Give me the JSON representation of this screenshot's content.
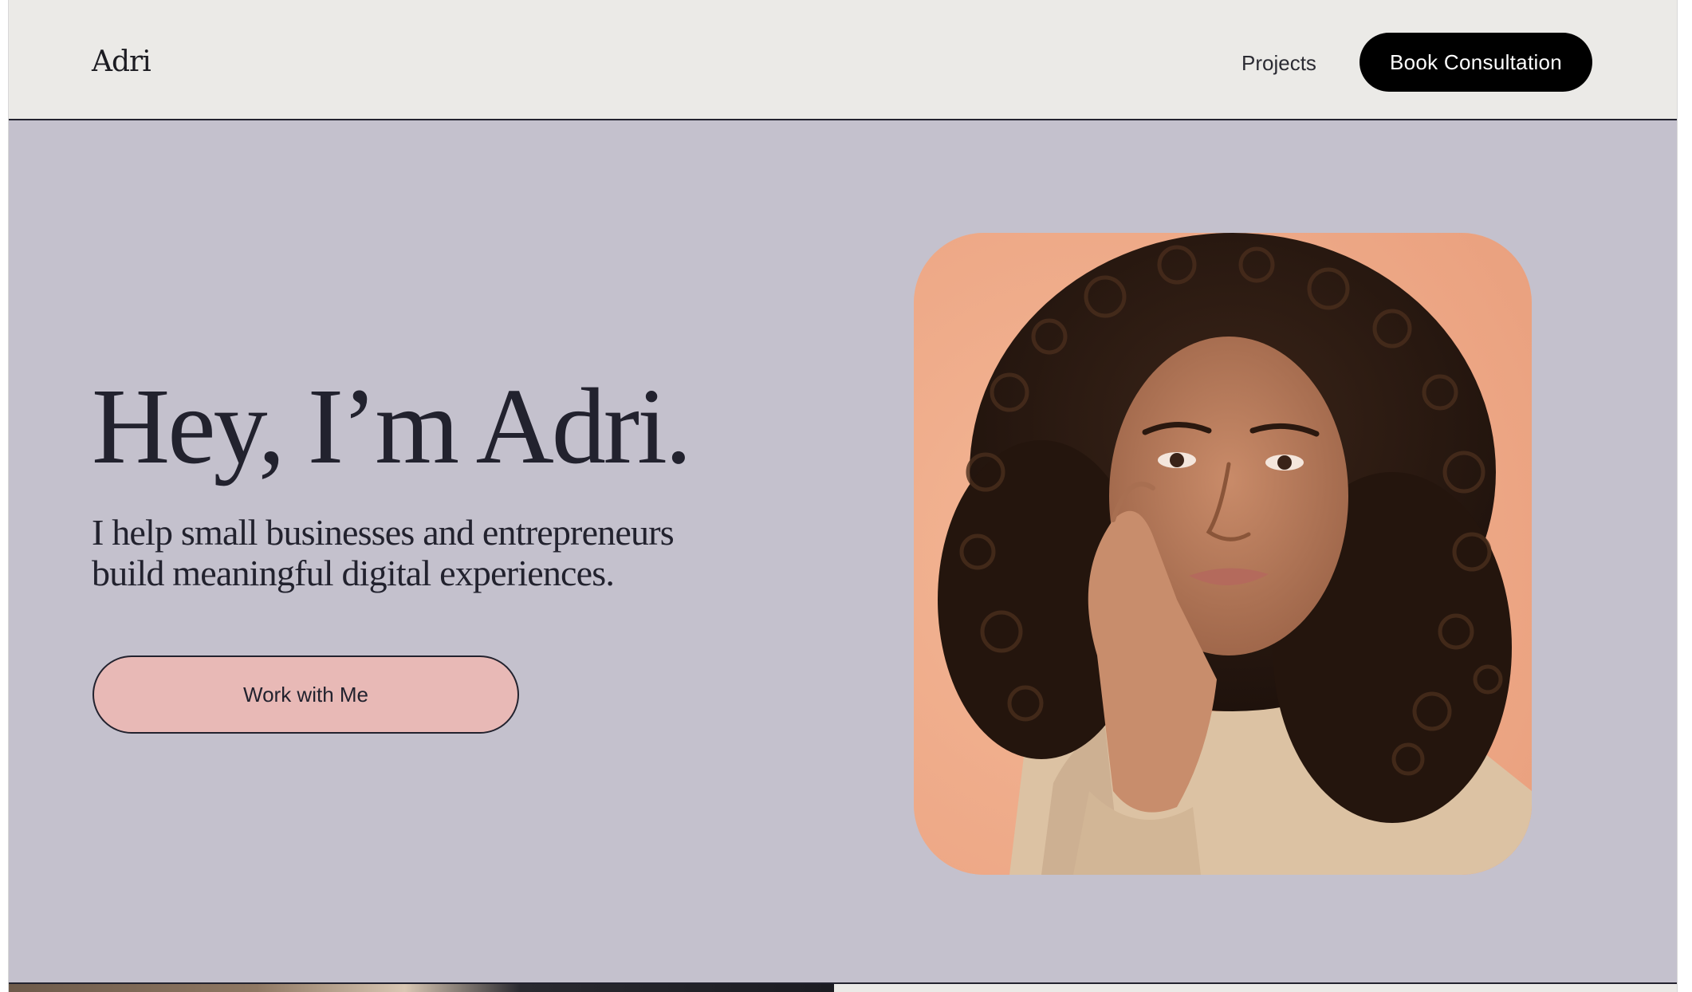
{
  "header": {
    "logo": "Adri",
    "nav_projects": "Projects",
    "cta_label": "Book Consultation"
  },
  "hero": {
    "title": "Hey, I’m Adri.",
    "subtitle": "I help small businesses and entrepreneurs build meaningful digital experiences.",
    "button_label": "Work with Me"
  },
  "colors": {
    "hero_background": "#c4c1cd",
    "header_background": "#ebeae7",
    "button_pink": "#e8b9b6",
    "text_dark": "#22222e",
    "cta_black": "#000000",
    "portrait_backdrop": "#f1ae8d"
  }
}
